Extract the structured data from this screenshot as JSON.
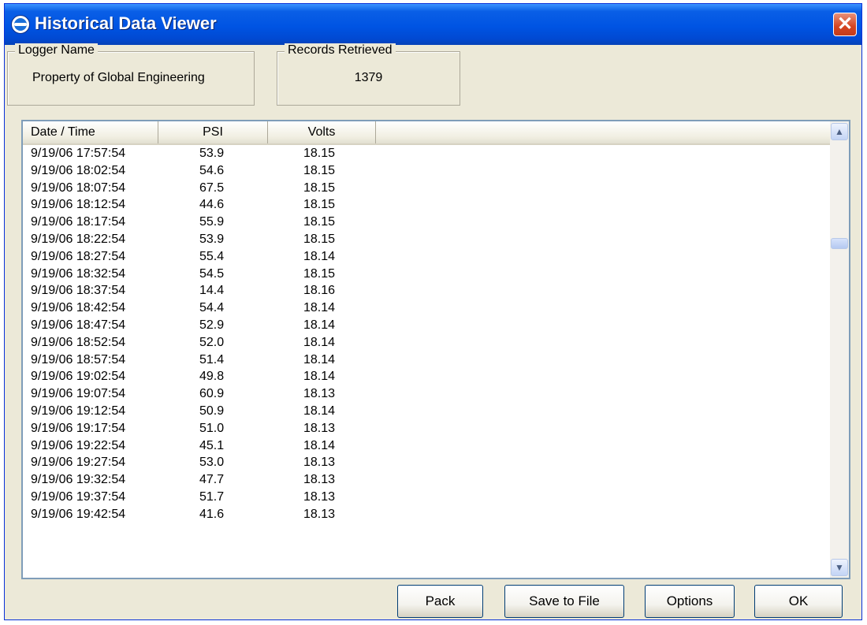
{
  "window": {
    "title": "Historical Data Viewer",
    "close_label": "✕"
  },
  "logger": {
    "legend": "Logger Name",
    "value": "Property of Global Engineering"
  },
  "records": {
    "legend": "Records Retrieved",
    "value": "1379"
  },
  "table": {
    "columns": [
      "Date / Time",
      "PSI",
      "Volts"
    ],
    "rows": [
      [
        "9/19/06 17:57:54",
        "53.9",
        "18.15"
      ],
      [
        "9/19/06 18:02:54",
        "54.6",
        "18.15"
      ],
      [
        "9/19/06 18:07:54",
        "67.5",
        "18.15"
      ],
      [
        "9/19/06 18:12:54",
        "44.6",
        "18.15"
      ],
      [
        "9/19/06 18:17:54",
        "55.9",
        "18.15"
      ],
      [
        "9/19/06 18:22:54",
        "53.9",
        "18.15"
      ],
      [
        "9/19/06 18:27:54",
        "55.4",
        "18.14"
      ],
      [
        "9/19/06 18:32:54",
        "54.5",
        "18.15"
      ],
      [
        "9/19/06 18:37:54",
        "14.4",
        "18.16"
      ],
      [
        "9/19/06 18:42:54",
        "54.4",
        "18.14"
      ],
      [
        "9/19/06 18:47:54",
        "52.9",
        "18.14"
      ],
      [
        "9/19/06 18:52:54",
        "52.0",
        "18.14"
      ],
      [
        "9/19/06 18:57:54",
        "51.4",
        "18.14"
      ],
      [
        "9/19/06 19:02:54",
        "49.8",
        "18.14"
      ],
      [
        "9/19/06 19:07:54",
        "60.9",
        "18.13"
      ],
      [
        "9/19/06 19:12:54",
        "50.9",
        "18.14"
      ],
      [
        "9/19/06 19:17:54",
        "51.0",
        "18.13"
      ],
      [
        "9/19/06 19:22:54",
        "45.1",
        "18.14"
      ],
      [
        "9/19/06 19:27:54",
        "53.0",
        "18.13"
      ],
      [
        "9/19/06 19:32:54",
        "47.7",
        "18.13"
      ],
      [
        "9/19/06 19:37:54",
        "51.7",
        "18.13"
      ],
      [
        "9/19/06 19:42:54",
        "41.6",
        "18.13"
      ]
    ],
    "scroll_position": 0.24
  },
  "buttons": {
    "pack": "Pack",
    "save": "Save to File",
    "options": "Options",
    "ok": "OK"
  },
  "colors": {
    "titlebar": "#0054e3",
    "window_face": "#ece9d8",
    "close_button": "#d54420",
    "list_border": "#7f9db9"
  },
  "icons": {
    "app": "logger-icon",
    "close": "close-icon",
    "scroll_up": "arrow-up-icon",
    "scroll_down": "arrow-down-icon"
  }
}
